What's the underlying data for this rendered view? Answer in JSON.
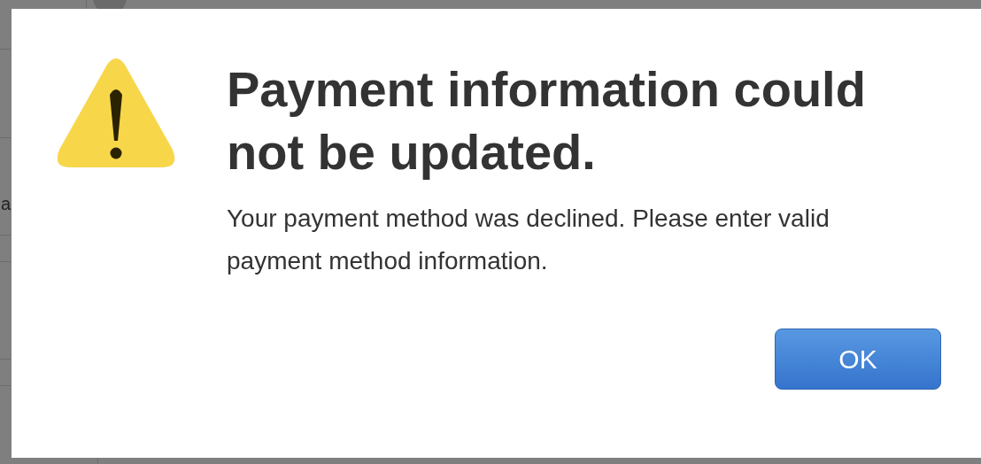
{
  "background": {
    "text": "a"
  },
  "dialog": {
    "title": "Payment information could not be updated.",
    "message": "Your payment method was declined. Please enter valid payment method information.",
    "buttons": [
      "OK"
    ]
  }
}
